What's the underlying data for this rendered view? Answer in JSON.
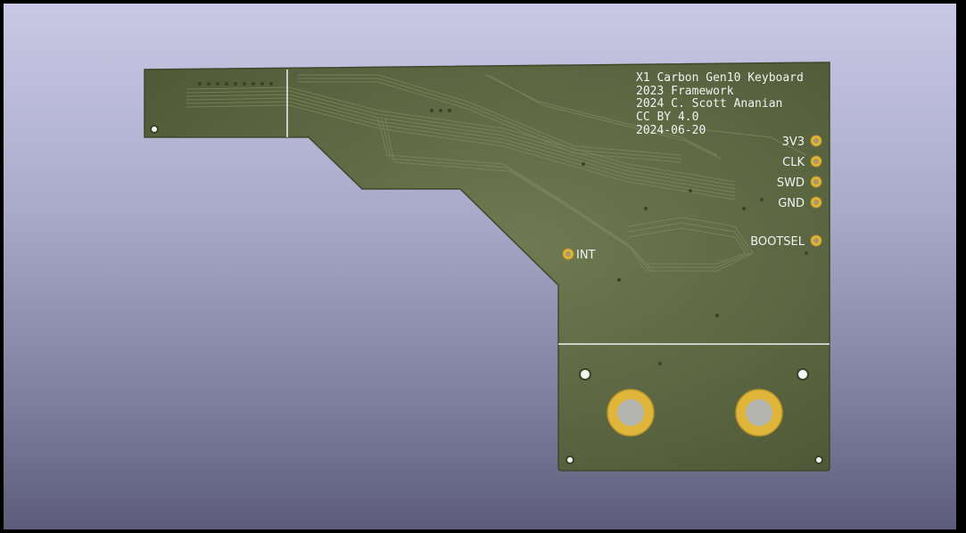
{
  "silkscreen": {
    "title_lines": [
      "X1 Carbon Gen10 Keyboard",
      "2023 Framework",
      "2024 C. Scott Ananian",
      "CC BY 4.0",
      "2024-06-20"
    ],
    "pads": {
      "v33": "3V3",
      "clk": "CLK",
      "swd": "SWD",
      "gnd": "GND",
      "bootsel": "BOOTSEL",
      "int": "INT"
    }
  },
  "colors": {
    "board": "#5f6a45",
    "board_edge": "#4a5334",
    "trace": "#6c7a52",
    "pad_gold": "#e0b63a",
    "silk": "#f2f2f2"
  }
}
